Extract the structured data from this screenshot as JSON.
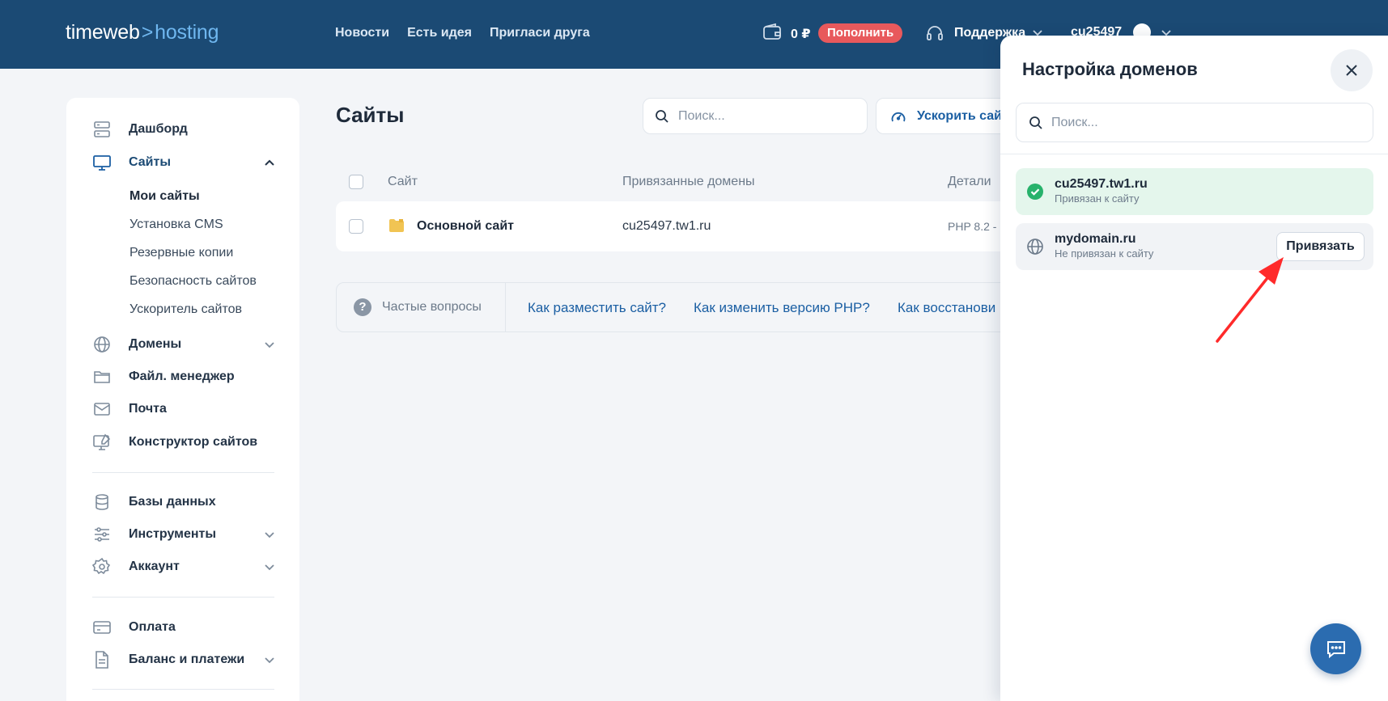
{
  "header": {
    "logo": {
      "brand": "timeweb",
      "chevron": ">",
      "product": "hosting"
    },
    "nav": [
      "Новости",
      "Есть идея",
      "Пригласи друга"
    ],
    "balance": "0 ₽",
    "topup_label": "Пополнить",
    "support_label": "Поддержка",
    "user_label": "cu25497",
    "colors": {
      "bg": "#1b4a74",
      "accent": "#6fb7ef",
      "topup": "#e8595c"
    }
  },
  "sidebar": {
    "items": [
      {
        "label": "Дашборд",
        "icon": "dashboard-icon"
      },
      {
        "label": "Сайты",
        "icon": "monitor-icon"
      },
      {
        "label": "Домены",
        "icon": "globe-icon"
      },
      {
        "label": "Файл. менеджер",
        "icon": "folder-icon"
      },
      {
        "label": "Почта",
        "icon": "mail-icon"
      },
      {
        "label": "Конструктор сайтов",
        "icon": "site-builder-icon"
      },
      {
        "label": "Базы данных",
        "icon": "database-icon"
      },
      {
        "label": "Инструменты",
        "icon": "sliders-icon"
      },
      {
        "label": "Аккаунт",
        "icon": "gear-icon"
      },
      {
        "label": "Оплата",
        "icon": "card-icon"
      },
      {
        "label": "Баланс и платежи",
        "icon": "document-icon"
      }
    ],
    "subitems": [
      "Мои сайты",
      "Установка CMS",
      "Резервные копии",
      "Безопасность сайтов",
      "Ускоритель сайтов"
    ]
  },
  "main": {
    "title": "Сайты",
    "search_placeholder": "Поиск...",
    "speedup_label": "Ускорить сайт",
    "columns": [
      "Сайт",
      "Привязанные домены",
      "Детали"
    ],
    "rows": [
      {
        "name": "Основной сайт",
        "domain": "cu25497.tw1.ru",
        "details": "PHP 8.2 -"
      }
    ],
    "faq": {
      "label": "Частые вопросы",
      "links": [
        "Как разместить сайт?",
        "Как изменить версию PHP?",
        "Как восстанови"
      ]
    }
  },
  "panel": {
    "title": "Настройка доменов",
    "search_placeholder": "Поиск...",
    "domains": [
      {
        "name": "cu25497.tw1.ru",
        "status": "Привязан к сайту"
      },
      {
        "name": "mydomain.ru",
        "status": "Не привязан к сайту",
        "action": "Привязать"
      }
    ]
  },
  "colors": {
    "link": "#1b5fa3",
    "success": "#27b26b",
    "arrow": "#ff2a2a",
    "chat": "#2b6cb0"
  }
}
